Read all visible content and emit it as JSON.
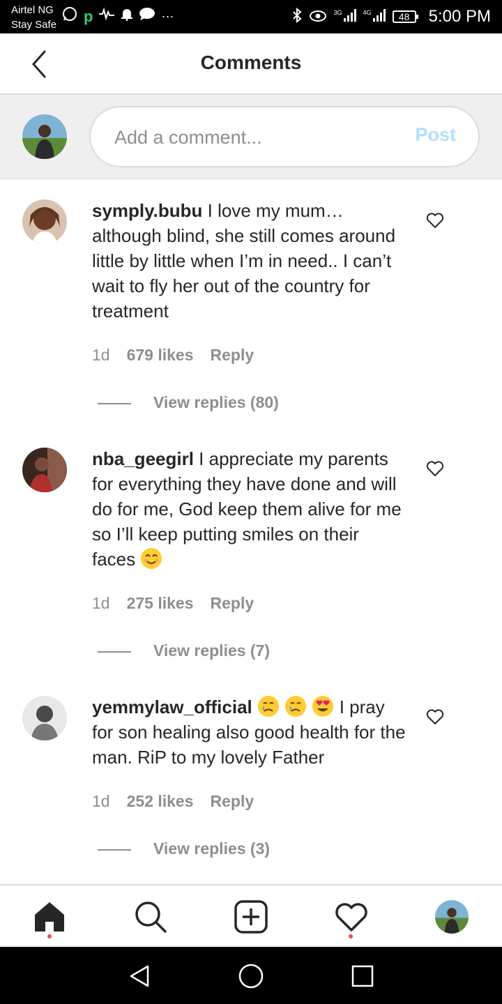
{
  "status_bar": {
    "carrier": "Airtel NG",
    "sub": "Stay Safe",
    "net1": "3G",
    "net2": "4G",
    "battery": "48",
    "time": "5:00 PM"
  },
  "header": {
    "title": "Comments"
  },
  "compose": {
    "placeholder": "Add a comment...",
    "post_label": "Post"
  },
  "comments": [
    {
      "username": "symply.bubu",
      "text": "I love my mum… although blind, she still comes around little by little when I’m in need.. I can’t wait to fly her out of the country for treatment",
      "time": "1d",
      "likes": "679 likes",
      "reply": "Reply",
      "view_replies": "View replies (80)"
    },
    {
      "username": "nba_geegirl",
      "text": "I appreciate my parents for everything they have done and will do for me, God keep them alive for me so I’ll keep putting smiles on their faces",
      "time": "1d",
      "likes": "275 likes",
      "reply": "Reply",
      "view_replies": "View replies (7)"
    },
    {
      "username": "yemmylaw_official",
      "text": "I pray for son healing also good health for the man. RiP to my lovely Father",
      "time": "1d",
      "likes": "252 likes",
      "reply": "Reply",
      "view_replies": "View replies (3)"
    }
  ],
  "icons": {
    "back": "chevron-left-icon",
    "heart": "heart-outline-icon",
    "home": "home-icon",
    "search": "search-icon",
    "add": "add-post-icon",
    "activity": "heart-icon",
    "profile": "profile-avatar"
  },
  "colors": {
    "post_disabled": "#b2dffc",
    "notification_dot": "#ed4956",
    "secondary_text": "#8e8e8e"
  }
}
